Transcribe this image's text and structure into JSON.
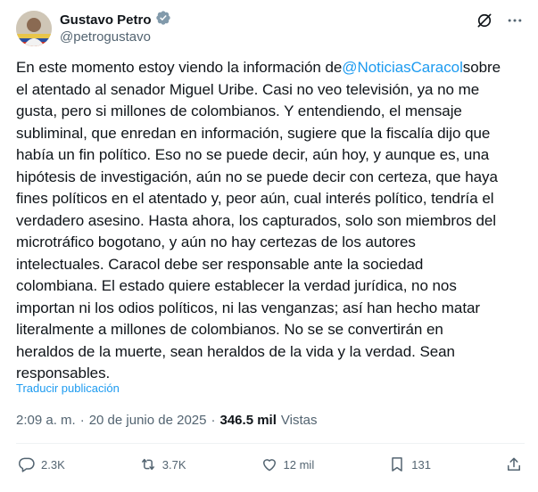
{
  "author": {
    "name": "Gustavo Petro",
    "handle": "@petrogustavo"
  },
  "tweet": {
    "before_mention": "En este momento estoy viendo la información de",
    "mention": "@NoticiasCaracol",
    "after_mention": "sobre\nel atentado al senador Miguel Uribe. Casi no veo televisión, ya no me\ngusta, pero si millones de colombianos. Y entendiendo, el mensaje\nsubliminal, que enredan en información, sugiere que la fiscalía dijo que\nhabía un fin político. Eso no se puede decir, aún hoy, y aunque es, una\nhipótesis de investigación, aún no se puede decir con certeza, que haya\nfines políticos en el atentado y, peor aún, cual interés político, tendría el\nverdadero asesino. Hasta ahora, los capturados, solo son miembros del\nmicrotráfico bogotano, y aún no hay certezas de los autores\nintelectuales. Caracol debe ser responsable ante la sociedad\ncolombiana. El estado quiere establecer la verdad jurídica, no nos\nimportan ni los odios políticos, ni las venganzas; así han hecho matar\nliteralmente a millones de colombianos. No se se convertirán en\nheraldos de la muerte, sean heraldos de la vida y la verdad. Sean\nresponsables.",
    "translate_label": "Traducir publicación"
  },
  "meta": {
    "time": "2:09 a. m.",
    "separator": "·",
    "date": "20 de junio de 2025",
    "views_count": "346.5 mil",
    "views_label": "Vistas"
  },
  "actions": {
    "replies": "2.3K",
    "reposts": "3.7K",
    "likes": "12 mil",
    "bookmarks": "131"
  },
  "colors": {
    "accent": "#1d9bf0",
    "muted": "#536471",
    "text": "#0f1419",
    "divider": "#eff3f4"
  }
}
